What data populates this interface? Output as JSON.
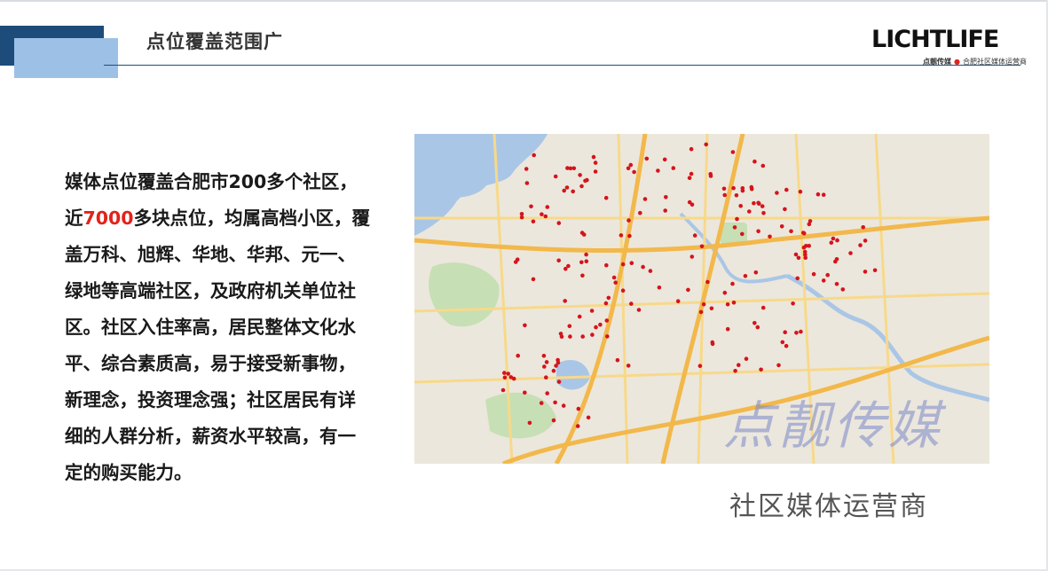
{
  "header": {
    "title": "点位覆盖范围广",
    "logo": {
      "letters": [
        {
          "ch": "L",
          "color": "#111111"
        },
        {
          "ch": "I",
          "color": "#111111"
        },
        {
          "ch": "C",
          "color": "#111111"
        },
        {
          "ch": "H",
          "color": "#111111"
        },
        {
          "ch": "T",
          "color": "#111111"
        },
        {
          "ch": "L",
          "color": "#111111"
        },
        {
          "ch": "I",
          "color": "#111111"
        },
        {
          "ch": "F",
          "color": "#111111"
        },
        {
          "ch": "E",
          "color": "#111111"
        }
      ],
      "tag_bold": "点靓传媒",
      "tag_sep": "●",
      "tag_rest": "合肥社区媒体运营商"
    }
  },
  "body": {
    "lines": [
      {
        "parts": [
          {
            "text": "媒体点位覆盖合肥市200多个社区，",
            "highlight": false
          }
        ]
      },
      {
        "parts": [
          {
            "text": "近",
            "highlight": false
          },
          {
            "text": "7000",
            "highlight": true
          },
          {
            "text": "多块点位，均属高档小区，覆",
            "highlight": false
          }
        ]
      },
      {
        "parts": [
          {
            "text": "盖万科、旭辉、华地、华邦、元一、",
            "highlight": false
          }
        ]
      },
      {
        "parts": [
          {
            "text": "绿地等高端社区，及政府机关单位社",
            "highlight": false
          }
        ]
      },
      {
        "parts": [
          {
            "text": "区。社区入住率高，居民整体文化水",
            "highlight": false
          }
        ]
      },
      {
        "parts": [
          {
            "text": "平、综合素质高，易于接受新事物，",
            "highlight": false
          }
        ]
      },
      {
        "parts": [
          {
            "text": "新理念，投资理念强；社区居民有详",
            "highlight": false
          }
        ]
      },
      {
        "parts": [
          {
            "text": "细的人群分析，薪资水平较高，有一",
            "highlight": false
          }
        ]
      },
      {
        "parts": [
          {
            "text": "定的购买能力。",
            "highlight": false
          }
        ]
      }
    ]
  },
  "map": {
    "watermark": "点靓传媒",
    "colors": {
      "land": "#ece7dc",
      "water": "#aac6e6",
      "green": "#c7dfb4",
      "road": "#f7d98a",
      "road_major": "#f2b84b",
      "marker": "#d4141c"
    }
  },
  "caption": "社区媒体运营商",
  "colors": {
    "accent_dark": "#1d4c7b",
    "accent_light": "#9dc1e6",
    "highlight": "#e2231a"
  }
}
